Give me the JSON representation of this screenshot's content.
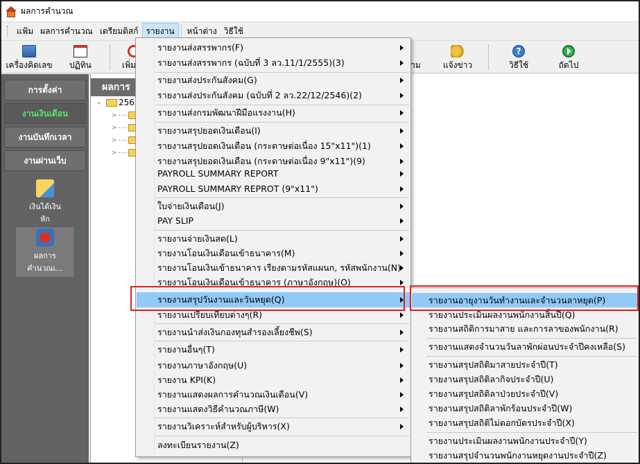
{
  "window": {
    "title": "ผลการคำนวณ"
  },
  "menubar": {
    "items": [
      "แฟ้ม",
      "ผลการคำนวณ",
      "เตรียมดิสก์",
      "รายงาน",
      "หน้าต่าง",
      "วิธีใช้"
    ],
    "active": "รายงาน"
  },
  "toolbar": {
    "calculator": "เครื่องคิดเลข",
    "calendar": "ปฏิทิน",
    "add": "เพิ่ม",
    "partial_label": "าม",
    "announce": "แจ้งข่าว",
    "help": "วิธีใช้",
    "next": "ถัดไป"
  },
  "sidebar": {
    "tabs": [
      "การตั้งค่า",
      "งานเงินเดือน",
      "งานบันทึกเวลา",
      "งานผ่านเว็บ"
    ],
    "selected_tab": "งานเงินเดือน",
    "items": [
      {
        "label_line1": "เงินได้เงิน",
        "label_line2": "หัก"
      },
      {
        "label_line1": "ผลการ",
        "label_line2": "คำนวณเ..."
      }
    ]
  },
  "panel": {
    "header": "ผลการ",
    "tree_root": "256"
  },
  "report_menu": {
    "items": [
      {
        "label": "รายงานส่งสรรพากร(F)",
        "submenu": true
      },
      {
        "label": "รายงานส่งสรรพากร (ฉบับที่ 3 ลว.11/1/2555)(3)",
        "submenu": true
      },
      {
        "label": "รายงานส่งประกันสังคม(G)",
        "submenu": true
      },
      {
        "label": "รายงานส่งประกันสังคม (ฉบับที่ 2 ลว.22/12/2546)(2)",
        "submenu": true
      },
      {
        "label": "รายงานส่งกรมพัฒนาฝีมือแรงงาน(H)",
        "submenu": true
      },
      {
        "label": "รายงานสรุปยอดเงินเดือน(I)",
        "submenu": true
      },
      {
        "label": "รายงานสรุปยอดเงินเดือน (กระดาษต่อเนื่อง 15\"x11\")(1)",
        "submenu": true
      },
      {
        "label": "รายงานสรุปยอดเงินเดือน (กระดาษต่อเนื่อง 9\"x11\")(9)",
        "submenu": true
      },
      {
        "label": "PAYROLL SUMMARY REPORT",
        "submenu": true
      },
      {
        "label": "PAYROLL SUMMARY REPROT (9\"x11\")",
        "submenu": true
      },
      {
        "label": "ใบจ่ายเงินเดือน(J)",
        "submenu": true
      },
      {
        "label": "PAY SLIP",
        "submenu": true
      },
      {
        "label": "รายงานจ่ายเงินสด(L)",
        "submenu": true
      },
      {
        "label": "รายงานโอนเงินเดือนเข้าธนาคาร(M)",
        "submenu": true
      },
      {
        "label": "รายงานโอนเงินเข้าธนาคาร เรียงตามรหัสแผนก, รหัสพนักงาน(N)",
        "submenu": true
      },
      {
        "label": "รายงานโอนเงินเดือนเข้าธนาคาร (ภาษาอังกฤษ)(O)",
        "submenu": true
      },
      {
        "label": "รายงานสรุปวันงานและวันหยุด(Q)",
        "submenu": true
      },
      {
        "label": "รายงานเปรียบเทียบต่างๆ(R)",
        "submenu": true
      },
      {
        "label": "รายงานนำส่งเงินกองทุนสำรองเลี้ยงชีพ(S)",
        "submenu": true
      },
      {
        "label": "รายงานอื่นๆ(T)",
        "submenu": true
      },
      {
        "label": "รายงานภาษาอังกฤษ(U)",
        "submenu": true
      },
      {
        "label": "รายงาน KPI(K)",
        "submenu": true
      },
      {
        "label": "รายงานแสดงผลการคำนวณเงินเดือน(V)",
        "submenu": true
      },
      {
        "label": "รายงานแสดงวิธีคำนวณภาษี(W)",
        "submenu": true
      },
      {
        "label": "รายงานวิเคราะห์สำหรับผู้บริหาร(X)",
        "submenu": true
      },
      {
        "label": "ลงทะเบียนรายงาน(Z)",
        "submenu": false
      }
    ],
    "highlighted": "รายงานสรุปวันงานและวันหยุด(Q)"
  },
  "leave_submenu": {
    "items": [
      "รายงานอายุงานวันทำงานและจำนวนลาหยุด(P)",
      "รายงานประเมินผลงานพนักงานสิ้นปี(Q)",
      "รายงานสถิติการมาสาย และการลาของพนักงาน(R)",
      "รายงานแสดงจำนวนวันลาพักผ่อนประจำปีคงเหลือ(S)",
      "รายงานสรุปสถิติมาสายประจำปี(T)",
      "รายงานสรุปสถิติลากิจประจำปี(U)",
      "รายงานสรุปสถิติลาป่วยประจำปี(V)",
      "รายงานสรุปสถิติลาพักร้อนประจำปี(W)",
      "รายงานสรุปสถิติไม่ตอกบัตรประจำปี(X)",
      "รายงานประเมินผลงานพนักงานประจำปี(Y)",
      "รายงานสรุปจำนวนพนักงานหยุดงานประจำปี(Z)"
    ],
    "highlighted": "รายงานอายุงานวันทำงานและจำนวนลาหยุด(P)"
  },
  "colors": {
    "highlight_box": "#e0201b",
    "menu_hover": "#91c9f7",
    "sidebar_bg": "#636363",
    "selected_tab_text": "#59e36d"
  }
}
